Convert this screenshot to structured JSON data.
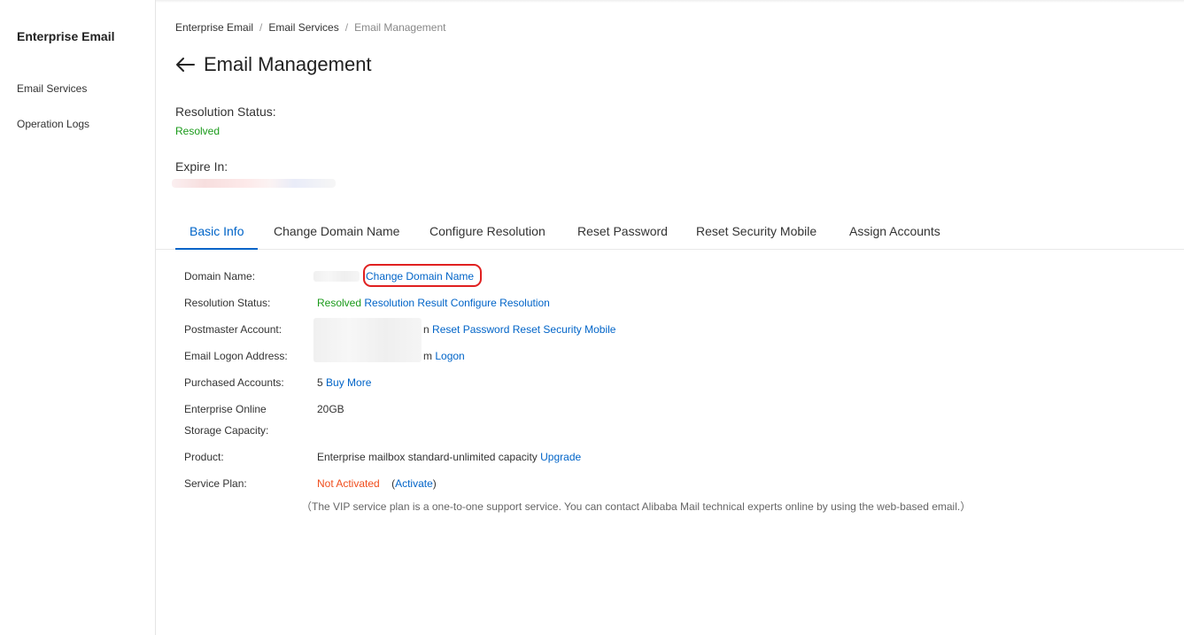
{
  "sidebar": {
    "title": "Enterprise Email",
    "items": [
      {
        "label": "Email Services"
      },
      {
        "label": "Operation Logs"
      }
    ]
  },
  "breadcrumb": [
    "Enterprise Email",
    "Email Services",
    "Email Management"
  ],
  "page": {
    "title": "Email Management",
    "resolution_status_label": "Resolution Status:",
    "resolution_status_value": "Resolved",
    "expire_label": "Expire In:"
  },
  "tabs": [
    {
      "label": "Basic Info",
      "active": true
    },
    {
      "label": "Change Domain Name"
    },
    {
      "label": "Configure Resolution"
    },
    {
      "label": "Reset Password"
    },
    {
      "label": "Reset Security Mobile"
    },
    {
      "label": "Assign Accounts"
    }
  ],
  "basic_info": {
    "domain": {
      "label": "Domain Name:",
      "link": "Change Domain Name"
    },
    "resolution": {
      "label": "Resolution Status:",
      "value": "Resolved",
      "link1": "Resolution Result",
      "link2": "Configure Resolution"
    },
    "postmaster": {
      "label": "Postmaster Account:",
      "suffix": "n",
      "link1": "Reset Password",
      "link2": "Reset Security Mobile"
    },
    "logon": {
      "label": "Email Logon Address:",
      "suffix": "m",
      "link": "Logon"
    },
    "accounts": {
      "label": "Purchased Accounts:",
      "value": "5",
      "link": "Buy More"
    },
    "storage": {
      "label_line1": "Enterprise Online",
      "label_line2": "Storage Capacity:",
      "value": "20GB"
    },
    "product": {
      "label": "Product:",
      "value": "Enterprise mailbox standard-unlimited capacity",
      "link": "Upgrade"
    },
    "service_plan": {
      "label": "Service Plan:",
      "status": "Not Activated",
      "open_paren": "(",
      "link": "Activate",
      "close_paren": ")"
    },
    "note": "（The VIP service plan is a one-to-one support service. You can contact Alibaba Mail technical experts online by using the web-based email.）"
  },
  "colors": {
    "accent": "#0064c8",
    "success": "#1a9a1a",
    "warning": "#f04e1d",
    "highlight": "#e02020"
  }
}
